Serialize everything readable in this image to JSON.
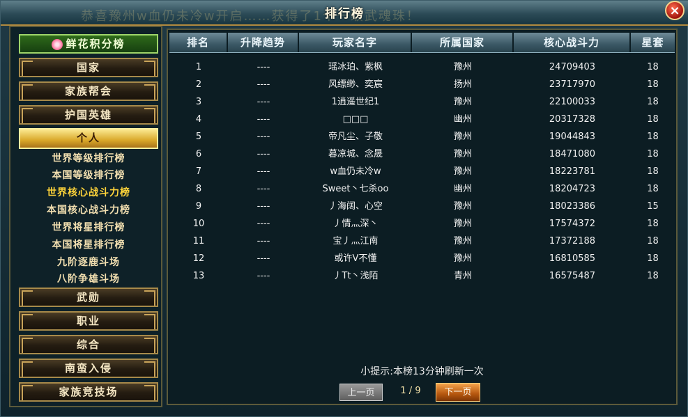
{
  "window": {
    "title": "排行榜",
    "close_label": "×",
    "ghost_text": "恭喜豫州w血仍未冷w开启……获得了1个一级武魂珠！"
  },
  "sidebar": {
    "top_button": "鲜花积分榜",
    "categories_upper": [
      "国家",
      "家族帮会",
      "护国英雄"
    ],
    "active_category": "个人",
    "sub_items": [
      "世界等级排行榜",
      "本国等级排行榜",
      "世界核心战斗力榜",
      "本国核心战斗力榜",
      "世界将星排行榜",
      "本国将星排行榜",
      "九阶逐鹿斗场",
      "八阶争雄斗场"
    ],
    "selected_sub_index": 2,
    "categories_lower": [
      "武勋",
      "职业",
      "综合",
      "南蛮入侵",
      "家族竞技场"
    ]
  },
  "table": {
    "headers": [
      "排名",
      "升降趋势",
      "玩家名字",
      "所属国家",
      "核心战斗力",
      "星套"
    ],
    "rows": [
      [
        "1",
        "----",
        "瑶冰珀、紫枫",
        "豫州",
        "24709403",
        "18"
      ],
      [
        "2",
        "----",
        "风缥缈、奕宸",
        "扬州",
        "23717970",
        "18"
      ],
      [
        "3",
        "----",
        "1逍遥世纪1",
        "豫州",
        "22100033",
        "18"
      ],
      [
        "4",
        "----",
        "□□□",
        "幽州",
        "20317328",
        "18"
      ],
      [
        "5",
        "----",
        "帝凡尘、子敬",
        "豫州",
        "19044843",
        "18"
      ],
      [
        "6",
        "----",
        "暮凉城、念晟",
        "豫州",
        "18471080",
        "18"
      ],
      [
        "7",
        "----",
        "w血仍未冷w",
        "豫州",
        "18223781",
        "18"
      ],
      [
        "8",
        "----",
        "Sweet丶七杀oo",
        "幽州",
        "18204723",
        "18"
      ],
      [
        "9",
        "----",
        "丿海阔、心空",
        "豫州",
        "18023386",
        "15"
      ],
      [
        "10",
        "----",
        "丿情灬深丶",
        "豫州",
        "17574372",
        "18"
      ],
      [
        "11",
        "----",
        "宝丿灬江南",
        "豫州",
        "17372188",
        "18"
      ],
      [
        "12",
        "----",
        "或许V不懂",
        "豫州",
        "16810585",
        "18"
      ],
      [
        "13",
        "----",
        "丿Tt丶浅陌",
        "青州",
        "16575487",
        "18"
      ]
    ]
  },
  "footer": {
    "tip": "小提示:本榜13分钟刷新一次",
    "prev_label": "上一页",
    "page_indicator": "1 / 9",
    "next_label": "下一页"
  },
  "colors": {
    "selected_sub": "#ffd43a",
    "active_category": "#e3b23a",
    "next_button": "#c86a1c"
  }
}
